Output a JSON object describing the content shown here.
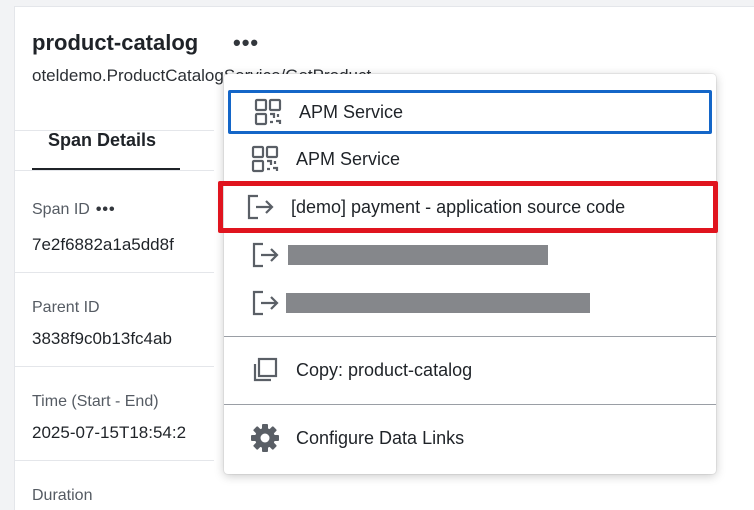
{
  "header": {
    "title": "product-catalog",
    "more_label": "•••",
    "subtitle": "oteldemo.ProductCatalogService/GetProduct"
  },
  "tabs": [
    {
      "label": "Span Details"
    }
  ],
  "fields": {
    "span_id": {
      "label": "Span ID",
      "value": "7e2f6882a1a5dd8f"
    },
    "parent_id": {
      "label": "Parent ID",
      "value": "3838f9c0b13fc4ab"
    },
    "time": {
      "label": "Time (Start - End)",
      "value": "2025-07-15T18:54:2"
    },
    "duration": {
      "label": "Duration"
    }
  },
  "menu": {
    "items": [
      {
        "label": "APM Service",
        "icon": "apm-service-icon",
        "state": "focused"
      },
      {
        "label": "APM Service",
        "icon": "apm-service-icon"
      },
      {
        "label": "[demo] payment - application source code",
        "icon": "external-link-icon",
        "state": "highlighted"
      },
      {
        "label": "",
        "icon": "external-link-icon",
        "redacted": true
      },
      {
        "label": "",
        "icon": "external-link-icon",
        "redacted": true
      },
      {
        "label": "Copy: product-catalog",
        "icon": "copy-icon"
      },
      {
        "label": "Configure Data Links",
        "icon": "gear-icon"
      }
    ]
  },
  "colors": {
    "focus_outline": "#1466c8",
    "highlight_outline": "#e0141e",
    "redaction": "#85878b"
  }
}
